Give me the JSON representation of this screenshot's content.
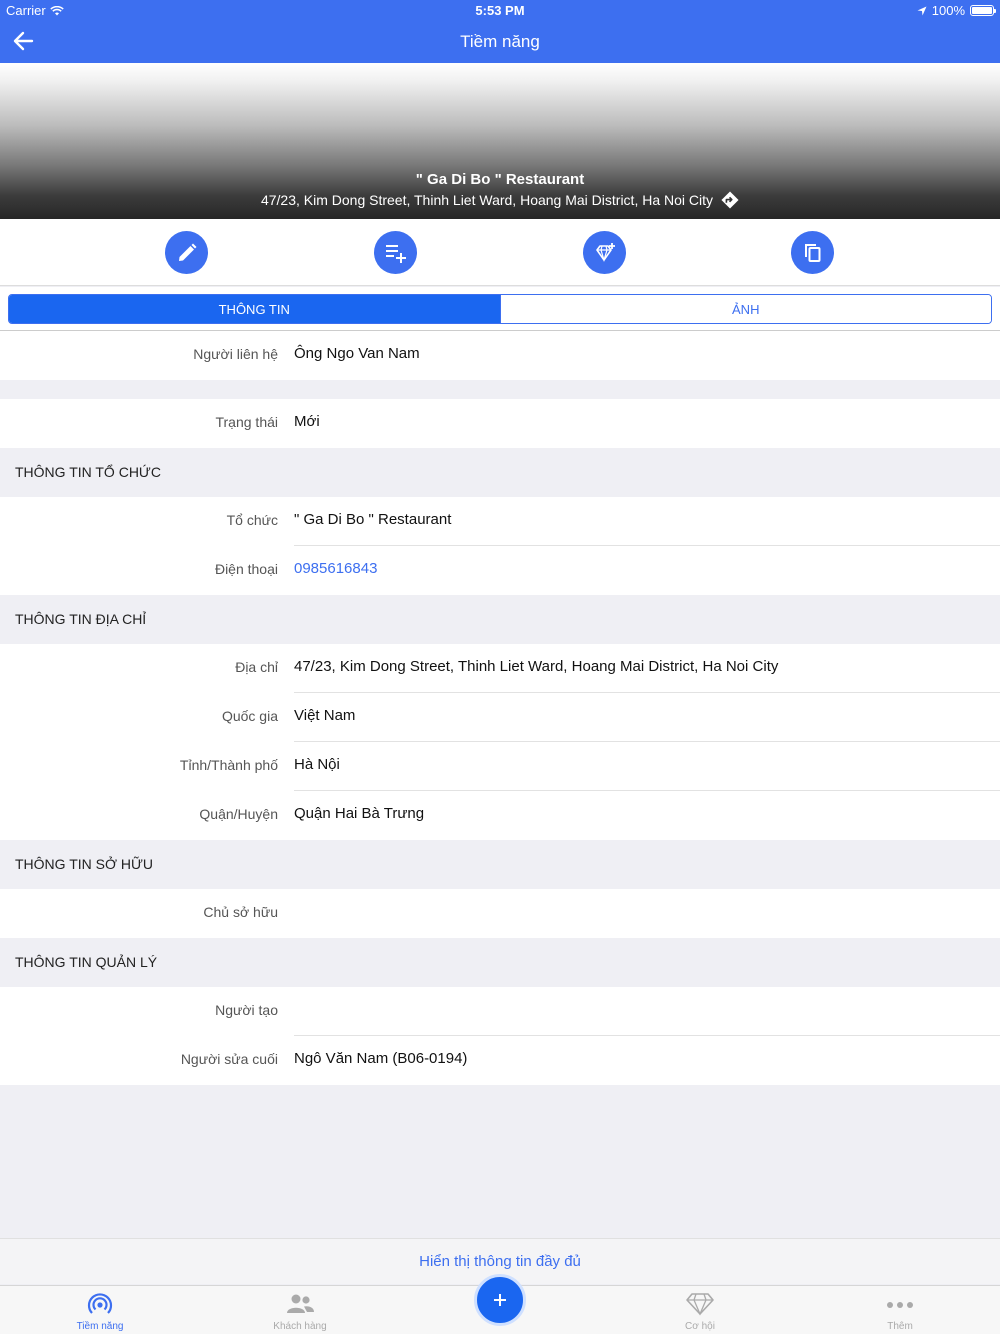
{
  "status_bar": {
    "carrier": "Carrier",
    "time": "5:53 PM",
    "battery": "100%"
  },
  "nav": {
    "title": "Tiềm năng"
  },
  "hero": {
    "name": "\" Ga Di Bo \" Restaurant",
    "address": "47/23, Kim Dong Street, Thinh Liet Ward, Hoang Mai District, Ha Noi City"
  },
  "actions": [
    "edit-icon",
    "add-list-icon",
    "add-diamond-icon",
    "copy-icon"
  ],
  "segments": {
    "info": "THÔNG TIN",
    "photo": "ẢNH"
  },
  "contact": {
    "label": "Người liên hệ",
    "salutation": "Ông",
    "name": "Ngo Van Nam"
  },
  "status": {
    "label": "Trạng thái",
    "value": "Mới"
  },
  "org_section": {
    "title": "THÔNG TIN TỔ CHỨC",
    "org_label": "Tổ chức",
    "org_value": "\" Ga Di Bo \" Restaurant",
    "phone_label": "Điện thoại",
    "phone_value": "0985616843"
  },
  "address_section": {
    "title": "THÔNG TIN ĐỊA CHỈ",
    "address_label": "Địa chỉ",
    "address_value": "47/23, Kim Dong Street, Thinh Liet Ward, Hoang Mai District, Ha Noi City",
    "country_label": "Quốc gia",
    "country_value": "Việt Nam",
    "province_label": "Tỉnh/Thành phố",
    "province_value": "Hà Nội",
    "district_label": "Quận/Huyện",
    "district_value": "Quận Hai Bà Trưng"
  },
  "owner_section": {
    "title": "THÔNG TIN SỞ HỮU",
    "owner_label": "Chủ sở hữu",
    "owner_value": ""
  },
  "manage_section": {
    "title": "THÔNG TIN QUẢN LÝ",
    "creator_label": "Người tạo",
    "creator_value": "",
    "modifier_label": "Người sửa cuối",
    "modifier_value": "Ngô Văn Nam (B06-0194)"
  },
  "show_full": "Hiển thị thông tin đầy đủ",
  "tabbar": {
    "tab1": "Tiềm năng",
    "tab2": "Khách hàng",
    "tab3": "Cơ hội",
    "tab4": "Thêm"
  },
  "colors": {
    "accent": "#3d6ff0",
    "segment_active": "#1a66f0",
    "background": "#efeff4"
  }
}
